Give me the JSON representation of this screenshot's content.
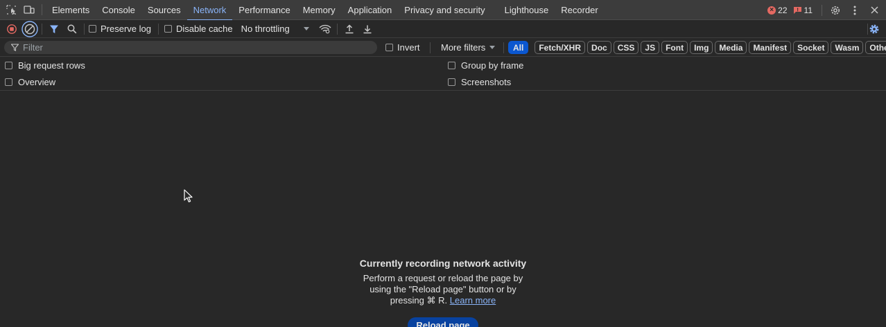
{
  "tabs": [
    {
      "label": "Elements"
    },
    {
      "label": "Console"
    },
    {
      "label": "Sources"
    },
    {
      "label": "Network"
    },
    {
      "label": "Performance"
    },
    {
      "label": "Memory"
    },
    {
      "label": "Application"
    },
    {
      "label": "Privacy and security"
    },
    {
      "label": "Lighthouse"
    },
    {
      "label": "Recorder"
    }
  ],
  "active_tab": "Network",
  "status": {
    "errors": "22",
    "warnings": "11"
  },
  "toolbar": {
    "preserve_log": "Preserve log",
    "disable_cache": "Disable cache",
    "throttling": "No throttling"
  },
  "filter": {
    "placeholder": "Filter",
    "invert": "Invert",
    "more_filters": "More filters",
    "chips": [
      "All",
      "Fetch/XHR",
      "Doc",
      "CSS",
      "JS",
      "Font",
      "Img",
      "Media",
      "Manifest",
      "Socket",
      "Wasm",
      "Other"
    ]
  },
  "settings": {
    "big_request_rows": "Big request rows",
    "overview": "Overview",
    "group_by_frame": "Group by frame",
    "screenshots": "Screenshots"
  },
  "empty_state": {
    "title": "Currently recording network activity",
    "body": "Perform a request or reload the page by using the \"Reload page\" button or by pressing ⌘ R.",
    "learn_more": "Learn more",
    "reload_button": "Reload page"
  },
  "colors": {
    "accent": "#8ab4f8",
    "background": "#282828",
    "tabbar": "#3c3c3c",
    "record_red": "#e46962",
    "chip_active": "#0b57d0"
  }
}
